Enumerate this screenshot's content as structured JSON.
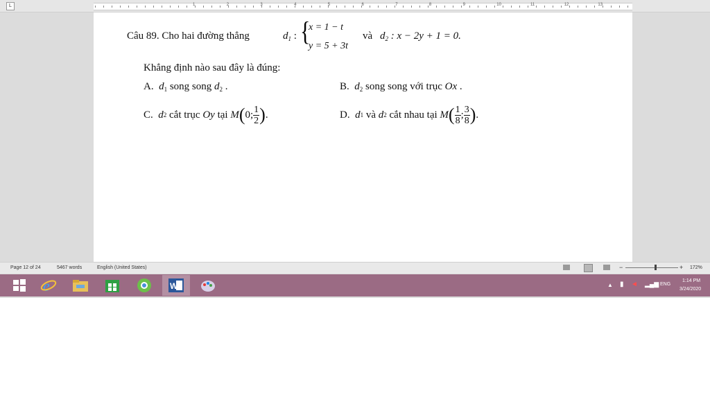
{
  "ruler": {
    "corner": "L",
    "numbers": [
      "1",
      "2",
      "3",
      "4",
      "5",
      "6",
      "7",
      "8",
      "9",
      "10",
      "11",
      "12",
      "13"
    ]
  },
  "doc": {
    "question_label": "Câu 89.",
    "question_text": "Cho hai đường thẳng",
    "d1_name": "d",
    "d1_sub": "1",
    "d1_eq1": "x = 1 − t",
    "d1_eq2": "y = 5 + 3t",
    "va": "và",
    "d2_name": "d",
    "d2_sub": "2",
    "d2_eq": ": x − 2y + 1 = 0.",
    "prompt": "Khẳng định nào sau đây là đúng:",
    "opt_a_label": "A.",
    "opt_a_text": "song song",
    "opt_b_label": "B.",
    "opt_b_text": "song song với trục",
    "opt_b_axis": "Ox",
    "opt_c_label": "C.",
    "opt_c_text": "cắt trục",
    "opt_c_axis": "Oy",
    "opt_c_tai": "tại",
    "opt_c_point": "M",
    "opt_c_x": "0;",
    "opt_c_num": "1",
    "opt_c_den": "2",
    "opt_d_label": "D.",
    "opt_d_va": "và",
    "opt_d_text": "cắt nhau tại",
    "opt_d_point": "M",
    "opt_d_num1": "1",
    "opt_d_den1": "8",
    "opt_d_num2": "3",
    "opt_d_den2": "8"
  },
  "status": {
    "page": "Page 12 of 24",
    "words": "5467 words",
    "language": "English (United States)",
    "zoom": "172%"
  },
  "taskbar": {
    "apps": [
      "windows-start",
      "internet-explorer",
      "file-explorer",
      "store",
      "chrome-like",
      "word",
      "paint"
    ],
    "word_letter": "W",
    "lang": "ENG",
    "time": "1:14 PM",
    "date": "3/24/2020"
  },
  "colors": {
    "taskbar": "#9b6b84",
    "app_bg": "#dcdcdc",
    "page": "#ffffff"
  }
}
